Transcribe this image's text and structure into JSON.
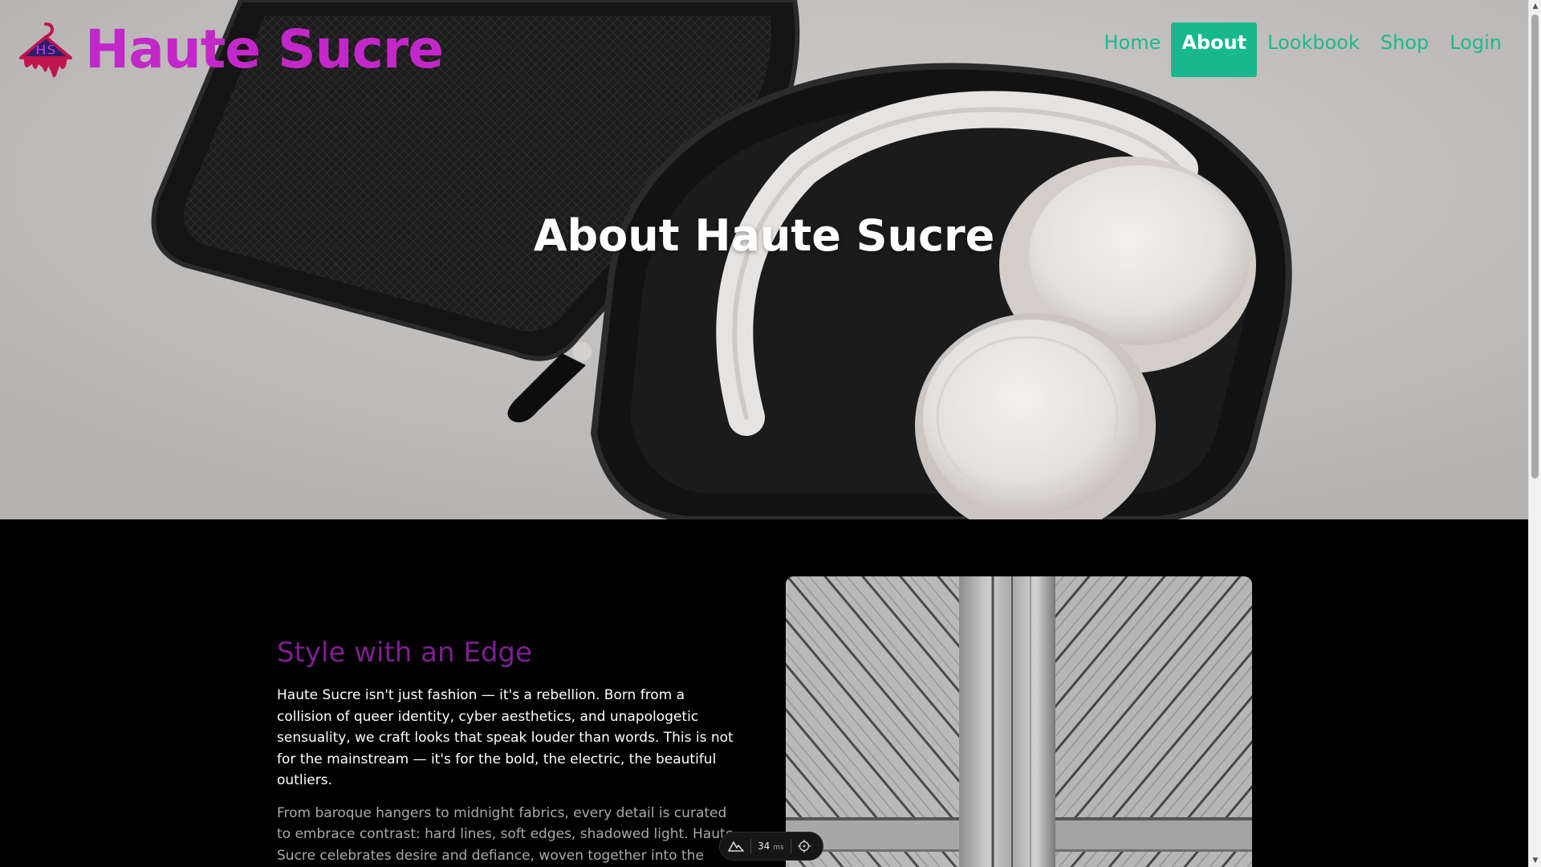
{
  "brand": {
    "logo_icon": "hanger-hs-logo-icon",
    "logo_text": "HS",
    "name": "Haute Sucre",
    "color": "#c427c9"
  },
  "nav": {
    "items": [
      {
        "label": "Home",
        "active": false
      },
      {
        "label": "About",
        "active": true
      },
      {
        "label": "Lookbook",
        "active": false
      },
      {
        "label": "Shop",
        "active": false
      },
      {
        "label": "Login",
        "active": false
      }
    ],
    "color": "#1cb98f",
    "active_bg": "#17b88d"
  },
  "hero": {
    "title": "About Haute Sucre",
    "image_icon": "headphones-in-case-image"
  },
  "about": {
    "heading": "Style with an Edge",
    "heading_color": "#7d1f8f",
    "paragraph1": "Haute Sucre isn't just fashion — it's a rebellion. Born from a collision of queer identity, cyber aesthetics, and unapologetic sensuality, we craft looks that speak louder than words. This is not for the mainstream — it's for the bold, the electric, the beautiful outliers.",
    "paragraph2": "From baroque hangers to midnight fabrics, every detail is curated to embrace contrast: hard lines, soft edges, shadowed light. Haute Sucre celebrates desire and defiance, woven together into the seams of every piece.",
    "image_icon": "weathered-wood-door-image"
  },
  "dev_toolbar": {
    "logo_icon": "mountain-logo-icon",
    "timing_value": "34",
    "timing_unit": "ms",
    "inspect_icon": "crosshair-icon"
  }
}
